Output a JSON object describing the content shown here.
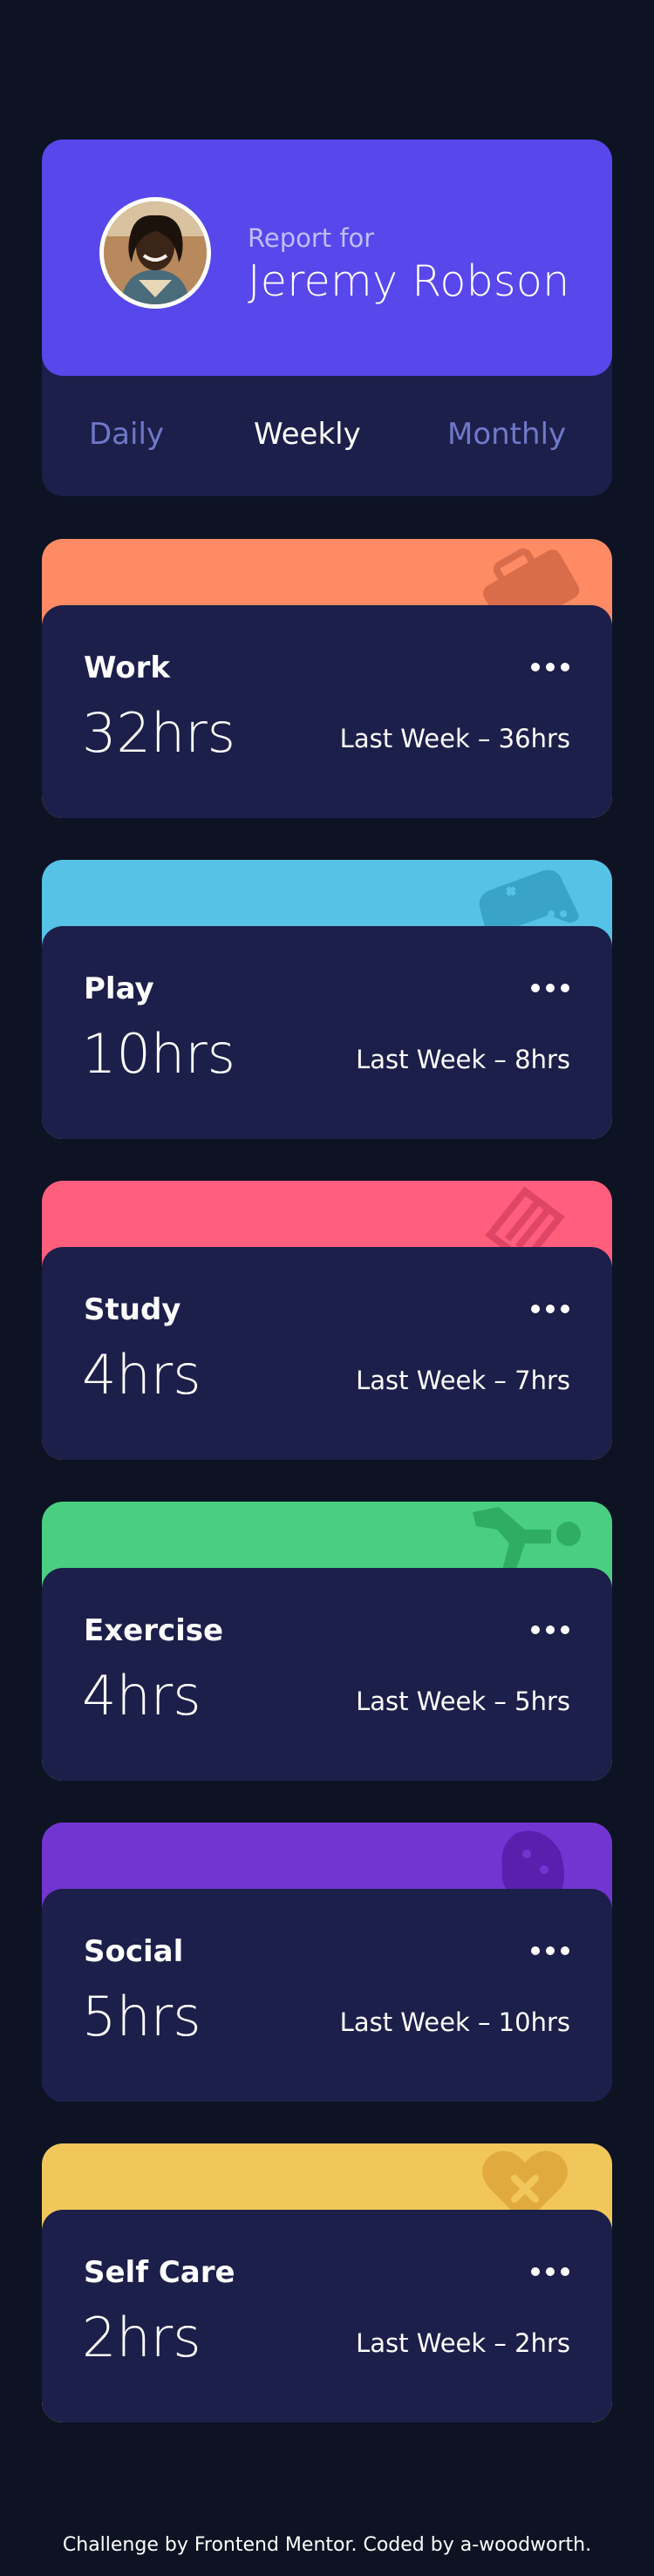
{
  "profile": {
    "report_label": "Report for",
    "name": "Jeremy Robson",
    "tabs": [
      {
        "label": "Daily",
        "active": false
      },
      {
        "label": "Weekly",
        "active": true
      },
      {
        "label": "Monthly",
        "active": false
      }
    ]
  },
  "activities": [
    {
      "title": "Work",
      "current": "32hrs",
      "previous": "Last Week  –  36hrs",
      "color": "#ff8b64",
      "icon": "briefcase-icon"
    },
    {
      "title": "Play",
      "current": "10hrs",
      "previous": "Last Week  –  8hrs",
      "color": "#55c2e6",
      "icon": "gamepad-icon"
    },
    {
      "title": "Study",
      "current": "4hrs",
      "previous": "Last Week  –  7hrs",
      "color": "#ff5e7d",
      "icon": "book-icon"
    },
    {
      "title": "Exercise",
      "current": "4hrs",
      "previous": "Last Week  –  5hrs",
      "color": "#4acf81",
      "icon": "running-icon"
    },
    {
      "title": "Social",
      "current": "5hrs",
      "previous": "Last Week  –  10hrs",
      "color": "#7335d2",
      "icon": "chat-icon"
    },
    {
      "title": "Self Care",
      "current": "2hrs",
      "previous": "Last Week  –  2hrs",
      "color": "#f1c75b",
      "icon": "heart-bandage-icon"
    }
  ],
  "footer": "Challenge by Frontend Mentor. Coded by a-woodworth."
}
